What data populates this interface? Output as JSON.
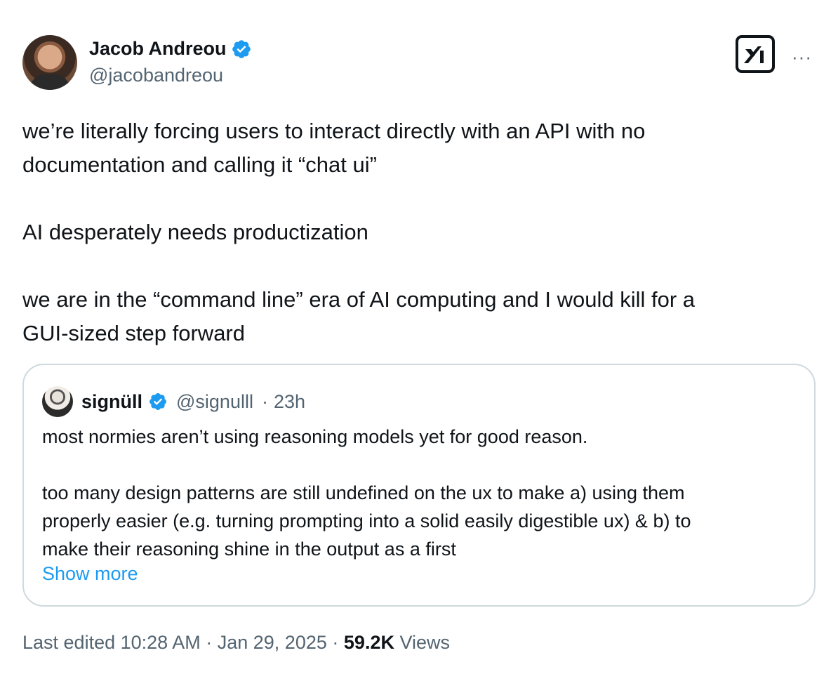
{
  "author": {
    "name": "Jacob Andreou",
    "handle": "@jacobandreou",
    "verified": true
  },
  "header_actions": {
    "grok_icon": "grok-icon",
    "more_icon": "more-icon",
    "more_label": "···"
  },
  "tweet": {
    "text": "we’re literally forcing users to interact directly with an API with no\ndocumentation and calling it “chat ui”\n\nAI desperately needs productization\n\nwe are in the “command line” era of AI computing and I would kill for a\nGUI-sized step forward"
  },
  "quoted_tweet": {
    "name": "signüll",
    "handle": "@signulll",
    "separator": "·",
    "time": "23h",
    "verified": true,
    "text": "most normies aren’t using reasoning models yet for good reason.\n\ntoo many design patterns are still undefined on the ux to make a) using them\nproperly easier (e.g. turning prompting into a solid easily digestible ux) & b) to\nmake their reasoning shine in the output as a first",
    "show_more_label": "Show more"
  },
  "meta": {
    "edited_label": "Last edited",
    "time": "10:28 AM",
    "separator": "·",
    "date": "Jan 29, 2025",
    "views_count": "59.2K",
    "views_label": "Views"
  },
  "colors": {
    "text_primary": "#0f1419",
    "text_secondary": "#536471",
    "link": "#1d9bf0",
    "verified": "#1d9bf0",
    "border": "#cfd9de"
  }
}
